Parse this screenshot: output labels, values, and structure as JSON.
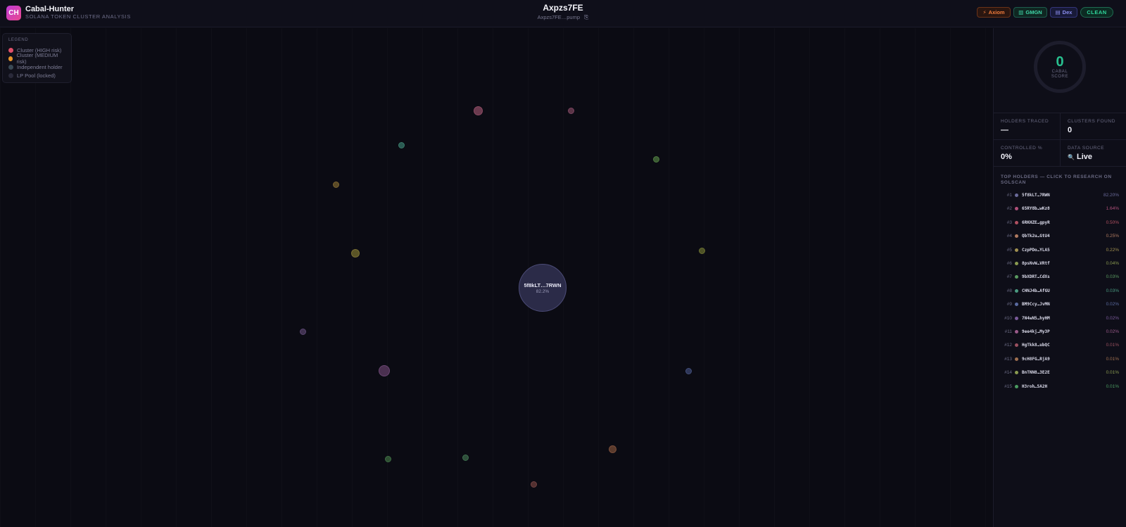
{
  "header": {
    "logo_text": "CH",
    "app_name": "Cabal-Hunter",
    "app_subtitle": "SOLANA TOKEN CLUSTER ANALYSIS",
    "token_name": "Axpzs7FE",
    "token_address": "Axpzs7FE…pump",
    "buttons": {
      "axiom": "Axiom",
      "gmgn": "GMGN",
      "dex": "Dex",
      "status": "CLEAN"
    }
  },
  "legend": {
    "title": "LEGEND",
    "items": [
      {
        "label": "Cluster (HIGH risk)",
        "color": "#e0506a"
      },
      {
        "label": "Cluster (MEDIUM risk)",
        "color": "#e8962a"
      },
      {
        "label": "Independent holder",
        "color": "#3a4a55"
      },
      {
        "label": "LP Pool (locked)",
        "color": "#2a2a3a"
      }
    ]
  },
  "graph": {
    "center_node": {
      "label": "5f8kLT…7RWN",
      "pct": "82.2%"
    }
  },
  "sidebar": {
    "score": {
      "value": "0",
      "label_line1": "CABAL",
      "label_line2": "SCORE"
    },
    "stats": {
      "holders_traced_label": "HOLDERS TRACED",
      "holders_traced_value": "—",
      "clusters_found_label": "CLUSTERS FOUND",
      "clusters_found_value": "0",
      "controlled_label": "CONTROLLED %",
      "controlled_value": "0%",
      "data_source_label": "DATA SOURCE",
      "data_source_value": "Live"
    },
    "holders_title": "TOP HOLDERS — CLICK TO RESEARCH ON SOLSCAN",
    "holders": [
      {
        "rank": "#1",
        "addr": "5f8kLT…7RWN",
        "pct": "82.20%",
        "color": "#6a6a9a",
        "pct_color": "#6a6a9a"
      },
      {
        "rank": "#2",
        "addr": "65RY8b…wKz8",
        "pct": "1.64%",
        "color": "#b0507a",
        "pct_color": "#b0507a"
      },
      {
        "rank": "#3",
        "addr": "6RKHZE…gpyR",
        "pct": "0.50%",
        "color": "#b05060",
        "pct_color": "#b05060"
      },
      {
        "rank": "#4",
        "addr": "QbTk2u…GtU4",
        "pct": "0.25%",
        "color": "#b07a60",
        "pct_color": "#b07a60"
      },
      {
        "rank": "#5",
        "addr": "CzpPDo…YLA5",
        "pct": "0.22%",
        "color": "#a09050",
        "pct_color": "#a09050"
      },
      {
        "rank": "#6",
        "addr": "8psNvW…VRtf",
        "pct": "0.04%",
        "color": "#8a9a50",
        "pct_color": "#8a9a50"
      },
      {
        "rank": "#7",
        "addr": "9bXDRT…CdXs",
        "pct": "0.03%",
        "color": "#5a9a60",
        "pct_color": "#5a9a60"
      },
      {
        "rank": "#8",
        "addr": "CHNJ4b…AfGU",
        "pct": "0.03%",
        "color": "#4a9a80",
        "pct_color": "#4a9a80"
      },
      {
        "rank": "#9",
        "addr": "BM9Ccy…JvMN",
        "pct": "0.02%",
        "color": "#5a6aa0",
        "pct_color": "#5a6aa0"
      },
      {
        "rank": "#10",
        "addr": "7N4wN5…hyHM",
        "pct": "0.02%",
        "color": "#7a5a9a",
        "pct_color": "#7a5a9a"
      },
      {
        "rank": "#11",
        "addr": "9ee4kj…My3P",
        "pct": "0.02%",
        "color": "#9a5a8a",
        "pct_color": "#9a5a8a"
      },
      {
        "rank": "#12",
        "addr": "HgTkk8…ubQC",
        "pct": "0.01%",
        "color": "#9a5060",
        "pct_color": "#9a5060"
      },
      {
        "rank": "#13",
        "addr": "9cH8FG…RjA9",
        "pct": "0.01%",
        "color": "#a07050",
        "pct_color": "#a07050"
      },
      {
        "rank": "#14",
        "addr": "BnTNN8…3E2E",
        "pct": "0.01%",
        "color": "#8a9a50",
        "pct_color": "#8a9a50"
      },
      {
        "rank": "#15",
        "addr": "H3roh…5A2H",
        "pct": "0.01%",
        "color": "#4a9a60",
        "pct_color": "#4a9a60"
      }
    ]
  }
}
